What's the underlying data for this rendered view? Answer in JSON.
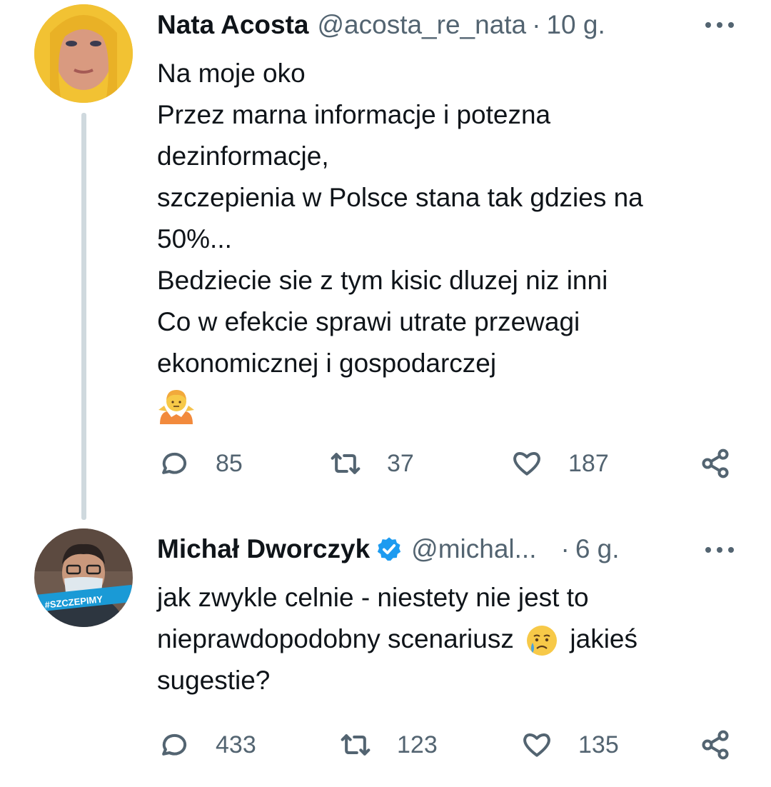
{
  "tweet1": {
    "name": "Nata Acosta",
    "handle": "@acosta_re_nata",
    "separator": "·",
    "time": "10 g.",
    "lines": [
      "Na moje oko",
      "Przez marna informacje i potezna",
      "dezinformacje,",
      "szczepienia w Polsce stana tak gdzies na",
      "50%...",
      "Bedziecie sie z tym kisic dluzej niz inni",
      "Co w efekcie sprawi utrate przewagi",
      "ekonomicznej i gospodarczej"
    ],
    "emoji_icon": "person-shrugging-emoji",
    "replies": "85",
    "retweets": "37",
    "likes": "187"
  },
  "tweet2": {
    "name": "Michał Dworczyk",
    "handle": "@michal...",
    "separator": "·",
    "time": "6 g.",
    "line1": "jak zwykle celnie - niestety nie jest to",
    "line2_before": "nieprawdopodobny scenariusz",
    "line2_after": "jakieś",
    "line3": "sugestie?",
    "emoji_icon": "crying-face-emoji",
    "avatar_badge": "#SZCZEPIMY",
    "replies": "433",
    "retweets": "123",
    "likes": "135"
  },
  "colors": {
    "text": "#0f1419",
    "secondary": "#536471",
    "verified": "#1d9bf0",
    "thread_line": "#cfd9de"
  }
}
